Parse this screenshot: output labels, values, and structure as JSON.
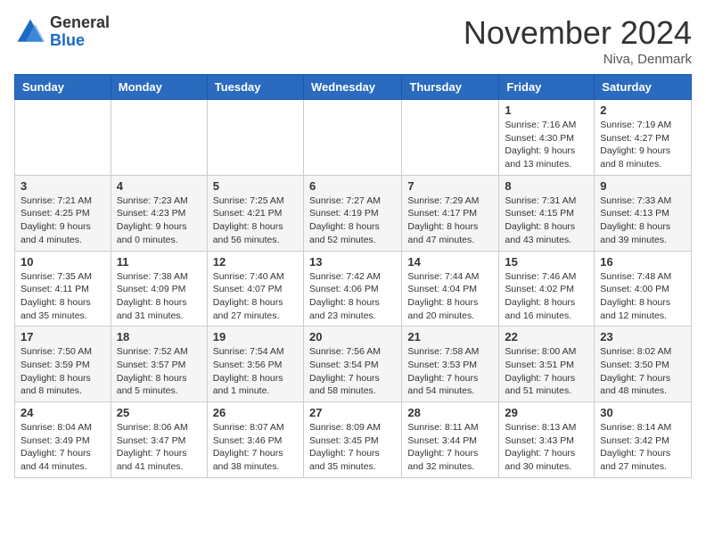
{
  "header": {
    "logo_general": "General",
    "logo_blue": "Blue",
    "month_title": "November 2024",
    "location": "Niva, Denmark"
  },
  "days_of_week": [
    "Sunday",
    "Monday",
    "Tuesday",
    "Wednesday",
    "Thursday",
    "Friday",
    "Saturday"
  ],
  "weeks": [
    [
      {
        "day": "",
        "info": ""
      },
      {
        "day": "",
        "info": ""
      },
      {
        "day": "",
        "info": ""
      },
      {
        "day": "",
        "info": ""
      },
      {
        "day": "",
        "info": ""
      },
      {
        "day": "1",
        "info": "Sunrise: 7:16 AM\nSunset: 4:30 PM\nDaylight: 9 hours and 13 minutes."
      },
      {
        "day": "2",
        "info": "Sunrise: 7:19 AM\nSunset: 4:27 PM\nDaylight: 9 hours and 8 minutes."
      }
    ],
    [
      {
        "day": "3",
        "info": "Sunrise: 7:21 AM\nSunset: 4:25 PM\nDaylight: 9 hours and 4 minutes."
      },
      {
        "day": "4",
        "info": "Sunrise: 7:23 AM\nSunset: 4:23 PM\nDaylight: 9 hours and 0 minutes."
      },
      {
        "day": "5",
        "info": "Sunrise: 7:25 AM\nSunset: 4:21 PM\nDaylight: 8 hours and 56 minutes."
      },
      {
        "day": "6",
        "info": "Sunrise: 7:27 AM\nSunset: 4:19 PM\nDaylight: 8 hours and 52 minutes."
      },
      {
        "day": "7",
        "info": "Sunrise: 7:29 AM\nSunset: 4:17 PM\nDaylight: 8 hours and 47 minutes."
      },
      {
        "day": "8",
        "info": "Sunrise: 7:31 AM\nSunset: 4:15 PM\nDaylight: 8 hours and 43 minutes."
      },
      {
        "day": "9",
        "info": "Sunrise: 7:33 AM\nSunset: 4:13 PM\nDaylight: 8 hours and 39 minutes."
      }
    ],
    [
      {
        "day": "10",
        "info": "Sunrise: 7:35 AM\nSunset: 4:11 PM\nDaylight: 8 hours and 35 minutes."
      },
      {
        "day": "11",
        "info": "Sunrise: 7:38 AM\nSunset: 4:09 PM\nDaylight: 8 hours and 31 minutes."
      },
      {
        "day": "12",
        "info": "Sunrise: 7:40 AM\nSunset: 4:07 PM\nDaylight: 8 hours and 27 minutes."
      },
      {
        "day": "13",
        "info": "Sunrise: 7:42 AM\nSunset: 4:06 PM\nDaylight: 8 hours and 23 minutes."
      },
      {
        "day": "14",
        "info": "Sunrise: 7:44 AM\nSunset: 4:04 PM\nDaylight: 8 hours and 20 minutes."
      },
      {
        "day": "15",
        "info": "Sunrise: 7:46 AM\nSunset: 4:02 PM\nDaylight: 8 hours and 16 minutes."
      },
      {
        "day": "16",
        "info": "Sunrise: 7:48 AM\nSunset: 4:00 PM\nDaylight: 8 hours and 12 minutes."
      }
    ],
    [
      {
        "day": "17",
        "info": "Sunrise: 7:50 AM\nSunset: 3:59 PM\nDaylight: 8 hours and 8 minutes."
      },
      {
        "day": "18",
        "info": "Sunrise: 7:52 AM\nSunset: 3:57 PM\nDaylight: 8 hours and 5 minutes."
      },
      {
        "day": "19",
        "info": "Sunrise: 7:54 AM\nSunset: 3:56 PM\nDaylight: 8 hours and 1 minute."
      },
      {
        "day": "20",
        "info": "Sunrise: 7:56 AM\nSunset: 3:54 PM\nDaylight: 7 hours and 58 minutes."
      },
      {
        "day": "21",
        "info": "Sunrise: 7:58 AM\nSunset: 3:53 PM\nDaylight: 7 hours and 54 minutes."
      },
      {
        "day": "22",
        "info": "Sunrise: 8:00 AM\nSunset: 3:51 PM\nDaylight: 7 hours and 51 minutes."
      },
      {
        "day": "23",
        "info": "Sunrise: 8:02 AM\nSunset: 3:50 PM\nDaylight: 7 hours and 48 minutes."
      }
    ],
    [
      {
        "day": "24",
        "info": "Sunrise: 8:04 AM\nSunset: 3:49 PM\nDaylight: 7 hours and 44 minutes."
      },
      {
        "day": "25",
        "info": "Sunrise: 8:06 AM\nSunset: 3:47 PM\nDaylight: 7 hours and 41 minutes."
      },
      {
        "day": "26",
        "info": "Sunrise: 8:07 AM\nSunset: 3:46 PM\nDaylight: 7 hours and 38 minutes."
      },
      {
        "day": "27",
        "info": "Sunrise: 8:09 AM\nSunset: 3:45 PM\nDaylight: 7 hours and 35 minutes."
      },
      {
        "day": "28",
        "info": "Sunrise: 8:11 AM\nSunset: 3:44 PM\nDaylight: 7 hours and 32 minutes."
      },
      {
        "day": "29",
        "info": "Sunrise: 8:13 AM\nSunset: 3:43 PM\nDaylight: 7 hours and 30 minutes."
      },
      {
        "day": "30",
        "info": "Sunrise: 8:14 AM\nSunset: 3:42 PM\nDaylight: 7 hours and 27 minutes."
      }
    ]
  ]
}
